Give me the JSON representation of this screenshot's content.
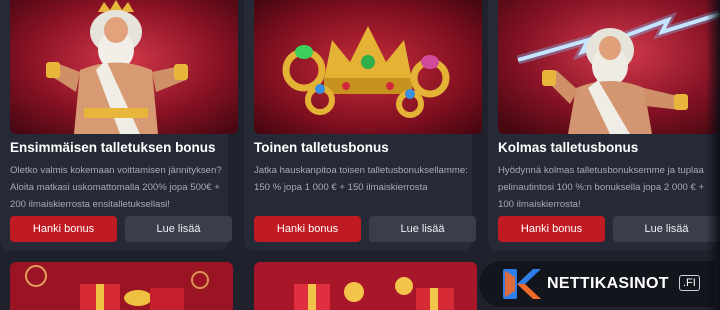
{
  "cards": [
    {
      "title": "Ensimmäisen talletuksen bonus",
      "description": "Oletko valmis kokemaan voittamisen jännityksen? Aloita matkasi uskomattomalla 200% jopa 500€ + 200 ilmaiskierrosta ensitalletuksellasi!",
      "primary_label": "Hanki bonus",
      "secondary_label": "Lue lisää",
      "image": "zeus-illustration"
    },
    {
      "title": "Toinen talletusbonus",
      "description": "Jatka hauskanpitoa toisen talletusbonuksellamme: 150 % jopa 1 000 € + 150 ilmaiskierrosta",
      "primary_label": "Hanki bonus",
      "secondary_label": "Lue lisää",
      "image": "crown-and-rings-illustration"
    },
    {
      "title": "Kolmas talletusbonus",
      "description": "Hyödynnä kolmas talletusbonuksemme ja tuplaa pelinautintosi 100 %:n bonuksella jopa 2 000 € + 100 ilmaiskierrosta!",
      "primary_label": "Hanki bonus",
      "secondary_label": "Lue lisää",
      "image": "zeus-lightning-illustration"
    }
  ],
  "brand": {
    "name": "NETTIKASINOT",
    "tld": ".FI"
  },
  "colors": {
    "background": "#1f222d",
    "card": "#262a36",
    "primary_button": "#c01a22",
    "secondary_button": "#3a3e4b",
    "brand_blue": "#2f7ee8",
    "brand_orange": "#f06a2a"
  }
}
